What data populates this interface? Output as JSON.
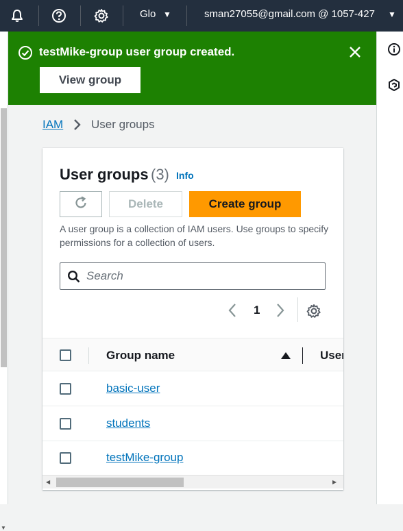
{
  "topbar": {
    "icons": [
      "bell-icon",
      "help-icon",
      "gear-icon"
    ],
    "region_label": "Glo",
    "account_label": "sman27055@gmail.com @ 1057-427"
  },
  "right_panel": {
    "icons": [
      "info-icon",
      "hexagon-icon"
    ]
  },
  "flash": {
    "message": "testMike-group user group created.",
    "view_button": "View group",
    "color": "#1d8102"
  },
  "breadcrumb": {
    "parent": "IAM",
    "current": "User groups"
  },
  "card": {
    "title": "User groups",
    "count": "(3)",
    "info_link": "Info",
    "delete_label": "Delete",
    "create_label": "Create group",
    "description": "A user group is a collection of IAM users. Use groups to specify permissions for a collection of users.",
    "search_placeholder": "Search",
    "page_number": "1"
  },
  "table": {
    "columns": [
      "Group name",
      "User"
    ],
    "rows": [
      {
        "name": "basic-user"
      },
      {
        "name": "students"
      },
      {
        "name": "testMike-group"
      }
    ]
  },
  "colors": {
    "accent": "#ff9900",
    "link": "#0073bb",
    "nav": "#232f3e"
  }
}
